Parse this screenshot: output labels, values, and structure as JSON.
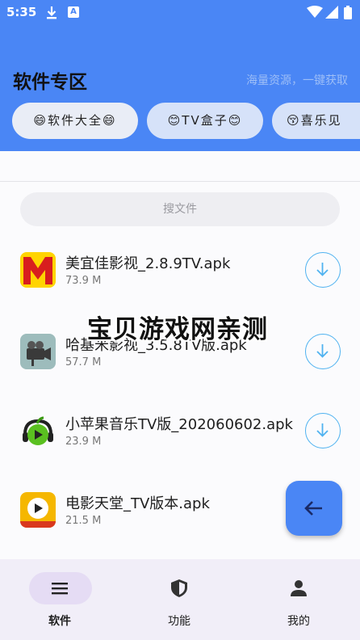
{
  "status_bar": {
    "time": "5:35"
  },
  "header": {
    "title": "软件专区",
    "subtitle": "海量资源，一键获取"
  },
  "chips": [
    {
      "label": "😄软件大全😄"
    },
    {
      "label": "😊TV盒子😊"
    },
    {
      "label": "😚喜乐见"
    }
  ],
  "search": {
    "placeholder": "搜文件"
  },
  "files": [
    {
      "name": "美宜佳影视_2.8.9TV.apk",
      "size": "73.9 M",
      "icon": "meiyijia-app-icon"
    },
    {
      "name": "哈基米影视_3.5.8TV版.apk",
      "size": "57.7 M",
      "icon": "camera-app-icon"
    },
    {
      "name": "小苹果音乐TV版_202060602.apk",
      "size": "23.9 M",
      "icon": "green-apple-app-icon"
    },
    {
      "name": "电影天堂_TV版本.apk",
      "size": "21.5 M",
      "icon": "movie-heaven-app-icon"
    }
  ],
  "watermark": "宝贝游戏网亲测",
  "bottom_nav": [
    {
      "label": "软件",
      "icon": "menu-icon",
      "active": true
    },
    {
      "label": "功能",
      "icon": "shield-icon",
      "active": false
    },
    {
      "label": "我的",
      "icon": "person-icon",
      "active": false
    }
  ],
  "colors": {
    "primary": "#4a86f5",
    "download_ring": "#4fb2f0",
    "nav_active_pill": "#e5dcf4"
  }
}
